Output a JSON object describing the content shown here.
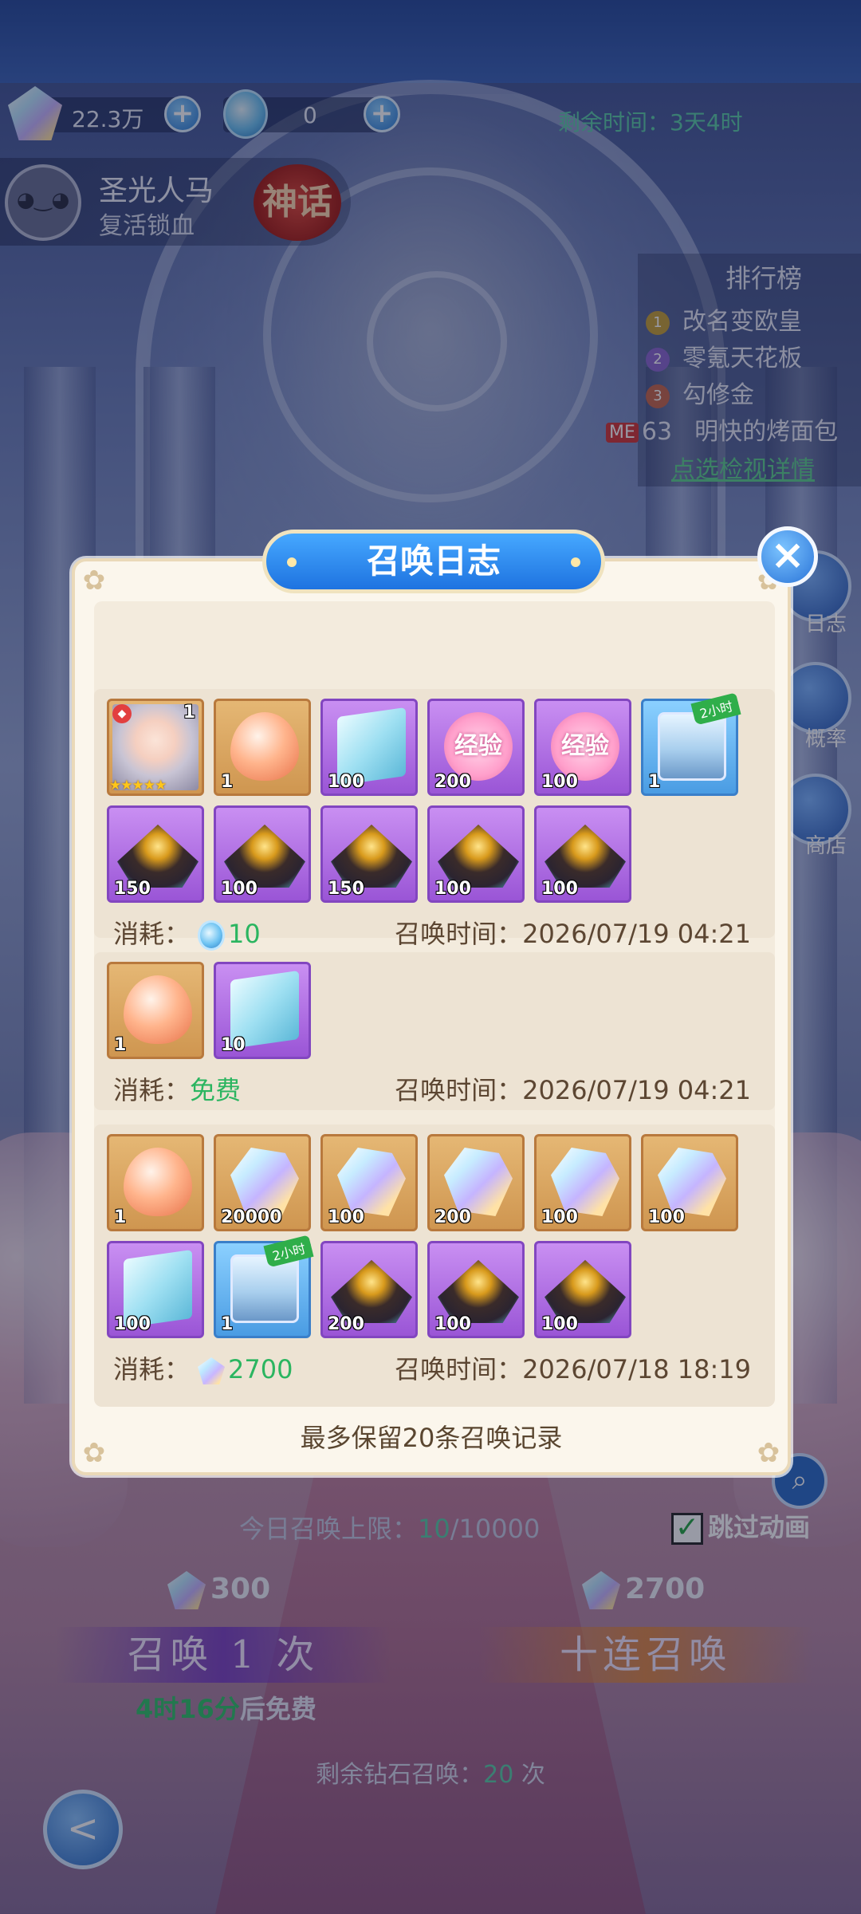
{
  "hud": {
    "diamond_amount": "22.3万",
    "ticket_amount": "0",
    "remaining_time": "剩余时间：3天4时"
  },
  "hero": {
    "name": "圣光人马",
    "skill": "复活锁血",
    "rarity_badge": "神话"
  },
  "ranking": {
    "title": "排行榜",
    "rows": [
      {
        "rank": "1",
        "name": "改名变欧皇"
      },
      {
        "rank": "2",
        "name": "零氪天花板"
      },
      {
        "rank": "3",
        "name": "勾修金"
      }
    ],
    "me_tag": "ME",
    "me_rank": "63",
    "me_name": "明快的烤面包",
    "detail_link": "点选检视详情"
  },
  "side": {
    "log_label": "日志",
    "rate_label": "概率",
    "shop_label": "商店"
  },
  "modal": {
    "title": "召唤日志",
    "close_icon": "×",
    "footer": "最多保留20条召唤记录",
    "entries": [
      {
        "items": [
          {
            "type": "hero",
            "qty": "1",
            "stars": "★★★★★"
          },
          {
            "type": "egg",
            "qty": "1"
          },
          {
            "type": "book",
            "qty": "100"
          },
          {
            "type": "exp",
            "qty": "200",
            "label": "经验"
          },
          {
            "type": "exp",
            "qty": "100",
            "label": "经验"
          },
          {
            "type": "chest",
            "qty": "1",
            "tag": "2小时"
          },
          {
            "type": "ore",
            "qty": "150"
          },
          {
            "type": "ore",
            "qty": "100"
          },
          {
            "type": "ore",
            "qty": "150"
          },
          {
            "type": "ore",
            "qty": "100"
          },
          {
            "type": "ore",
            "qty": "100"
          }
        ],
        "cost_label": "消耗：",
        "cost_value": "10",
        "time_label": "召唤时间：",
        "time_value": "2026/07/19 04:21"
      },
      {
        "items": [
          {
            "type": "egg",
            "qty": "1"
          },
          {
            "type": "book",
            "qty": "10"
          }
        ],
        "cost_label": "消耗：",
        "cost_value": "免费",
        "time_label": "召唤时间：",
        "time_value": "2026/07/19 04:21"
      },
      {
        "items": [
          {
            "type": "egg",
            "qty": "1"
          },
          {
            "type": "gem",
            "qty": "20000"
          },
          {
            "type": "gem",
            "qty": "100"
          },
          {
            "type": "gem",
            "qty": "200"
          },
          {
            "type": "gem",
            "qty": "100"
          },
          {
            "type": "gem",
            "qty": "100"
          },
          {
            "type": "book",
            "qty": "100"
          },
          {
            "type": "chest",
            "qty": "1",
            "tag": "2小时"
          },
          {
            "type": "ore",
            "qty": "200"
          },
          {
            "type": "ore",
            "qty": "100"
          },
          {
            "type": "ore",
            "qty": "100"
          }
        ],
        "cost_label": "消耗：",
        "cost_value": "2700",
        "time_label": "召唤时间：",
        "time_value": "2026/07/18 18:19"
      }
    ]
  },
  "bottom": {
    "daily_prefix": "今日召唤上限：",
    "daily_used": "10",
    "daily_max": "/10000",
    "skip_label": "跳过动画",
    "single_cost": "300",
    "ten_cost": "2700",
    "single_label": "召唤 1 次",
    "ten_label": "十连召唤",
    "free_time": "4时16分",
    "free_suffix": "后免费",
    "remain_prefix": "剩余钻石召唤：",
    "remain_count": "20",
    "remain_suffix": " 次"
  }
}
